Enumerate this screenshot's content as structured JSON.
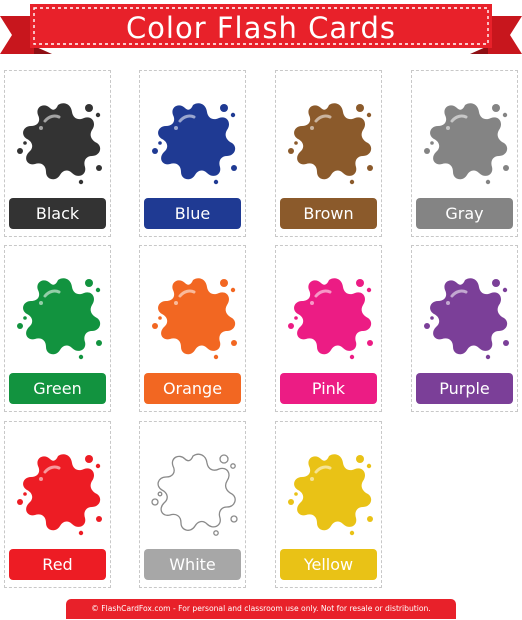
{
  "title": "Color Flash Cards",
  "brand_color": "#e8212a",
  "cards": [
    {
      "name": "Black",
      "color": "#333333",
      "icon": "paint-splat-icon"
    },
    {
      "name": "Blue",
      "color": "#1f3a93",
      "icon": "paint-splat-icon"
    },
    {
      "name": "Brown",
      "color": "#8b5a2b",
      "icon": "paint-splat-icon"
    },
    {
      "name": "Gray",
      "color": "#848484",
      "icon": "paint-splat-icon"
    },
    {
      "name": "Green",
      "color": "#12933f",
      "icon": "paint-splat-icon"
    },
    {
      "name": "Orange",
      "color": "#f26722",
      "icon": "paint-splat-icon"
    },
    {
      "name": "Pink",
      "color": "#ec1c84",
      "icon": "paint-splat-icon"
    },
    {
      "name": "Purple",
      "color": "#7b3f98",
      "icon": "paint-splat-icon"
    },
    {
      "name": "Red",
      "color": "#ed1c24",
      "icon": "paint-splat-icon"
    },
    {
      "name": "White",
      "color": "#ffffff",
      "label_color": "#a7a7a7",
      "icon": "paint-splat-icon"
    },
    {
      "name": "Yellow",
      "color": "#e9c216",
      "icon": "paint-splat-icon"
    }
  ],
  "footer": "© FlashCardFox.com - For personal and classroom use only. Not for resale or distribution."
}
